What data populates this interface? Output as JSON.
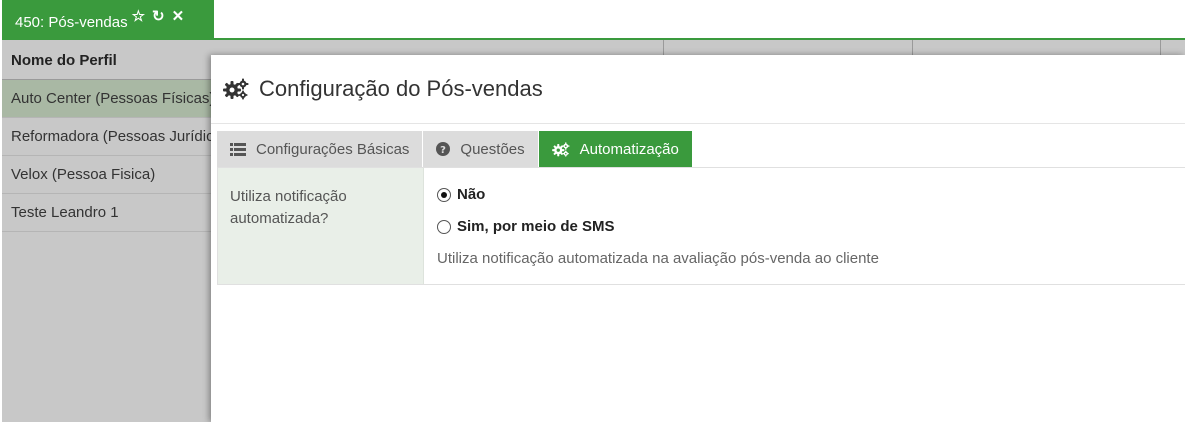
{
  "window_tab": {
    "label": "450: Pós-vendas"
  },
  "background_table": {
    "header": "Nome do Perfil",
    "rows": [
      "Auto Center (Pessoas Físicas)",
      "Reformadora (Pessoas Jurídicas)",
      "Velox (Pessoa Fisica)",
      "Teste Leandro 1"
    ]
  },
  "modal": {
    "title": "Configuração do Pós-vendas",
    "tabs": [
      {
        "label": "Configurações Básicas",
        "icon": "list-icon"
      },
      {
        "label": "Questões",
        "icon": "question-circle-icon"
      },
      {
        "label": "Automatização",
        "icon": "gears-icon",
        "active": true
      }
    ],
    "field": {
      "label": "Utiliza notificação automatizada?",
      "options": [
        {
          "label": "Não",
          "checked": true
        },
        {
          "label": "Sim, por meio de SMS",
          "checked": false
        }
      ],
      "help": "Utiliza notificação automatizada na avaliação pós-venda ao cliente"
    }
  },
  "colors": {
    "accent": "#3a9a3d",
    "tab_inactive": "#dcdcdc",
    "label_bg": "#e9efe8"
  }
}
